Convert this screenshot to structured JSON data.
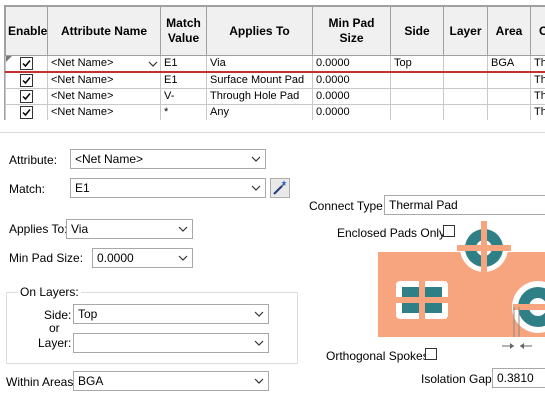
{
  "grid": {
    "columns": [
      {
        "key": "enable",
        "label": "Enable"
      },
      {
        "key": "attr",
        "label": "Attribute Name"
      },
      {
        "key": "match",
        "label": "Match Value"
      },
      {
        "key": "applies",
        "label": "Applies To"
      },
      {
        "key": "minpad",
        "label": "Min Pad Size"
      },
      {
        "key": "side",
        "label": "Side"
      },
      {
        "key": "layer",
        "label": "Layer"
      },
      {
        "key": "area",
        "label": "Area"
      },
      {
        "key": "conn",
        "label": "Co T"
      }
    ],
    "rows": [
      {
        "enabled": true,
        "attr": "<Net Name>",
        "match": "E1",
        "applies": "Via",
        "minpad": "0.0000",
        "side": "Top",
        "layer": "",
        "area": "BGA",
        "conn": "Ther"
      },
      {
        "enabled": true,
        "attr": "<Net Name>",
        "match": "E1",
        "applies": "Surface Mount Pad",
        "minpad": "0.0000",
        "side": "",
        "layer": "",
        "area": "",
        "conn": "Ther"
      },
      {
        "enabled": true,
        "attr": "<Net Name>",
        "match": "V-",
        "applies": "Through Hole Pad",
        "minpad": "0.0000",
        "side": "",
        "layer": "",
        "area": "",
        "conn": "Ther"
      },
      {
        "enabled": true,
        "attr": "<Net Name>",
        "match": "*",
        "applies": "Any",
        "minpad": "0.0000",
        "side": "",
        "layer": "",
        "area": "",
        "conn": "Ther"
      }
    ]
  },
  "form": {
    "attribute_label": "Attribute:",
    "attribute_value": "<Net Name>",
    "match_label": "Match:",
    "match_value": "E1",
    "applies_label": "Applies To:",
    "applies_value": "Via",
    "minpad_label": "Min Pad Size:",
    "minpad_value": "0.0000",
    "onlayers_label": "On Layers:",
    "side_label": "Side:",
    "side_value": "Top",
    "or_label": "or",
    "layer_label": "Layer:",
    "layer_value": "",
    "within_label": "Within Areas:",
    "within_value": "BGA",
    "connect_label": "Connect Type:",
    "connect_value": "Thermal Pad",
    "enclosed_label": "Enclosed Pads Only:",
    "orthogonal_label": "Orthogonal Spokes:",
    "isolation_label": "Isolation Gap:",
    "isolation_value": "0.3810"
  },
  "colors": {
    "preview_bg": "#f7a57f",
    "via_ring": "#2f7f86",
    "pad_fill": "#2f7f86",
    "selection_line": "#c43030"
  }
}
